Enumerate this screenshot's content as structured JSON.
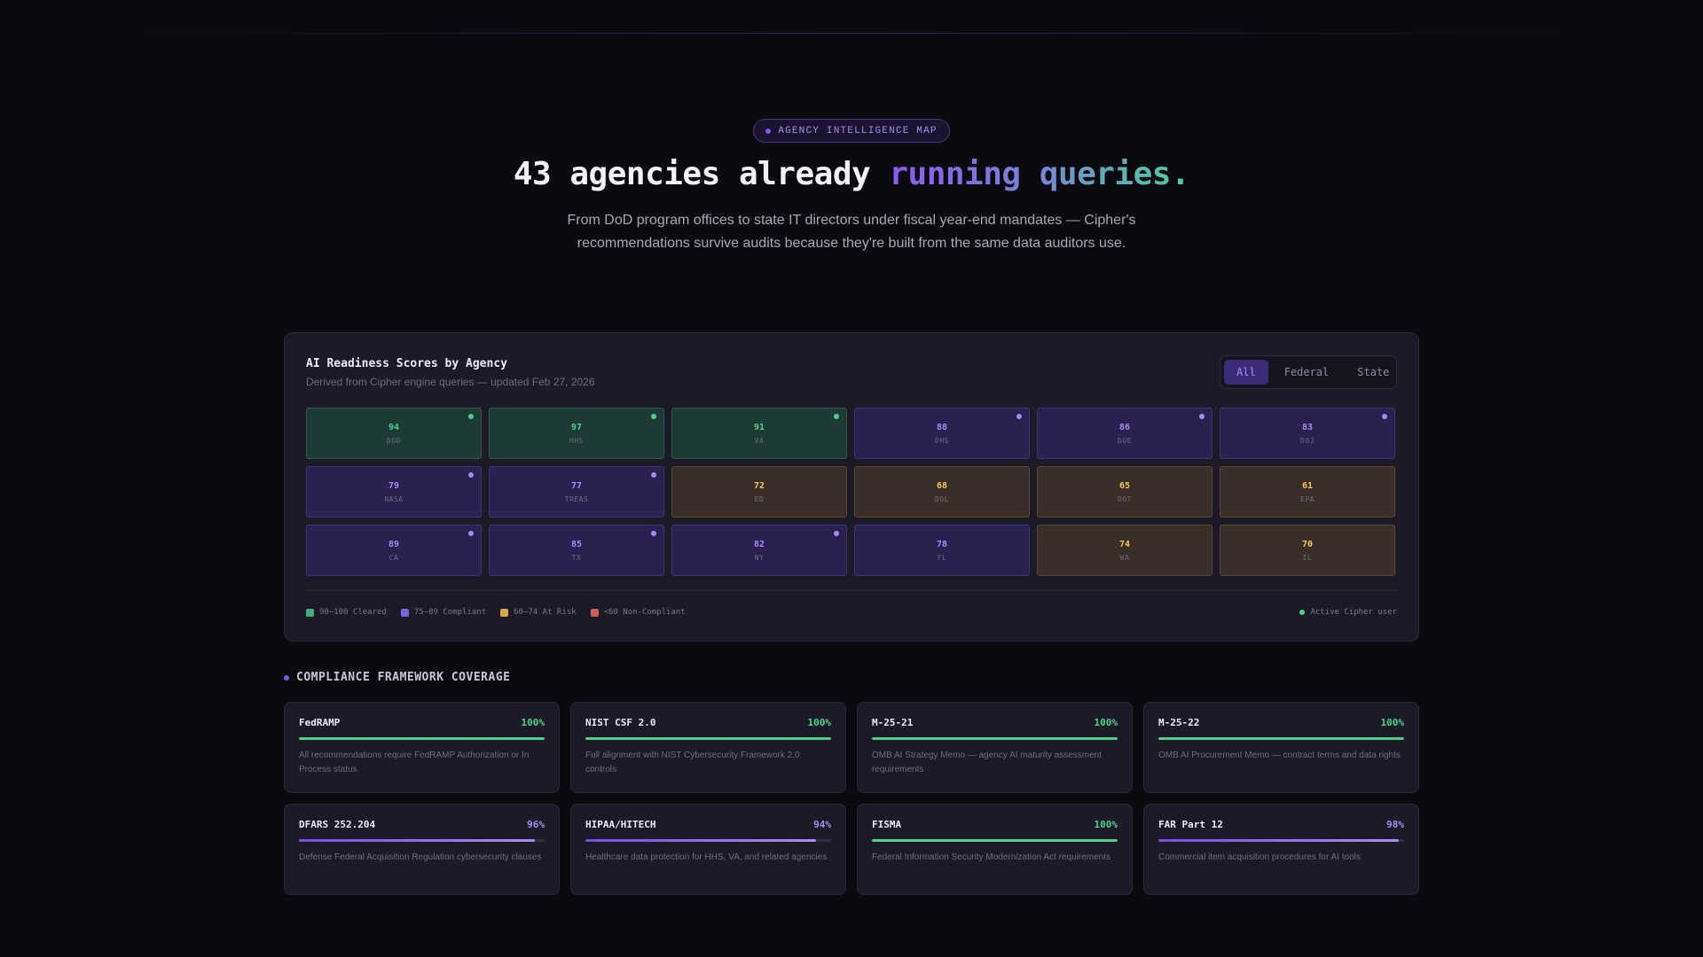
{
  "hero": {
    "badge": "AGENCY INTELLIGENCE MAP",
    "headline_plain": "43 agencies already ",
    "headline_accent": "running queries.",
    "subtitle": "From DoD program offices to state IT directors under fiscal year-end mandates — Cipher's recommendations survive audits because they're built from the same data auditors use."
  },
  "panel": {
    "title": "AI Readiness Scores by Agency",
    "subtitle": "Derived from Cipher engine queries — updated Feb 27, 2026",
    "filters": [
      "All",
      "Federal",
      "State"
    ],
    "active_filter": "All",
    "agencies": [
      {
        "score": "94",
        "name": "DOD",
        "tier": "green",
        "active": true
      },
      {
        "score": "97",
        "name": "HHS",
        "tier": "green",
        "active": true
      },
      {
        "score": "91",
        "name": "VA",
        "tier": "green",
        "active": true
      },
      {
        "score": "88",
        "name": "DHS",
        "tier": "purple",
        "active": true
      },
      {
        "score": "86",
        "name": "DOE",
        "tier": "purple",
        "active": true
      },
      {
        "score": "83",
        "name": "DOJ",
        "tier": "purple",
        "active": true
      },
      {
        "score": "79",
        "name": "NASA",
        "tier": "purple",
        "active": true
      },
      {
        "score": "77",
        "name": "TREAS",
        "tier": "purple",
        "active": true
      },
      {
        "score": "72",
        "name": "ED",
        "tier": "amber",
        "active": false
      },
      {
        "score": "68",
        "name": "DOL",
        "tier": "amber",
        "active": false
      },
      {
        "score": "65",
        "name": "DOT",
        "tier": "amber",
        "active": false
      },
      {
        "score": "61",
        "name": "EPA",
        "tier": "amber",
        "active": false
      },
      {
        "score": "89",
        "name": "CA",
        "tier": "purple",
        "active": true
      },
      {
        "score": "85",
        "name": "TX",
        "tier": "purple",
        "active": true
      },
      {
        "score": "82",
        "name": "NY",
        "tier": "purple",
        "active": true
      },
      {
        "score": "78",
        "name": "FL",
        "tier": "purple",
        "active": false
      },
      {
        "score": "74",
        "name": "WA",
        "tier": "amber",
        "active": false
      },
      {
        "score": "70",
        "name": "IL",
        "tier": "amber",
        "active": false
      }
    ],
    "legend": [
      {
        "label": "90–100 Cleared",
        "color": "#3fae7a"
      },
      {
        "label": "75–89 Compliant",
        "color": "#7a66d8"
      },
      {
        "label": "60–74 At Risk",
        "color": "#d8a84a"
      },
      {
        "label": "<60 Non-Compliant",
        "color": "#d45a5a"
      }
    ],
    "active_legend": "Active Cipher user"
  },
  "frameworks": {
    "title": "COMPLIANCE FRAMEWORK COVERAGE",
    "items": [
      {
        "name": "FedRAMP",
        "pct_label": "100%",
        "pct": 100,
        "tier": "green",
        "desc": "All recommendations require FedRAMP Authorization or In Process status"
      },
      {
        "name": "NIST CSF 2.0",
        "pct_label": "100%",
        "pct": 100,
        "tier": "green",
        "desc": "Full alignment with NIST Cybersecurity Framework 2.0 controls"
      },
      {
        "name": "M-25-21",
        "pct_label": "100%",
        "pct": 100,
        "tier": "green",
        "desc": "OMB AI Strategy Memo — agency AI maturity assessment requirements"
      },
      {
        "name": "M-25-22",
        "pct_label": "100%",
        "pct": 100,
        "tier": "green",
        "desc": "OMB AI Procurement Memo — contract terms and data rights"
      },
      {
        "name": "DFARS 252.204",
        "pct_label": "96%",
        "pct": 96,
        "tier": "purple",
        "desc": "Defense Federal Acquisition Regulation cybersecurity clauses"
      },
      {
        "name": "HIPAA/HITECH",
        "pct_label": "94%",
        "pct": 94,
        "tier": "purple",
        "desc": "Healthcare data protection for HHS, VA, and related agencies"
      },
      {
        "name": "FISMA",
        "pct_label": "100%",
        "pct": 100,
        "tier": "green",
        "desc": "Federal Information Security Modernization Act requirements"
      },
      {
        "name": "FAR Part 12",
        "pct_label": "98%",
        "pct": 98,
        "tier": "purple",
        "desc": "Commercial item acquisition procedures for AI tools"
      }
    ]
  }
}
